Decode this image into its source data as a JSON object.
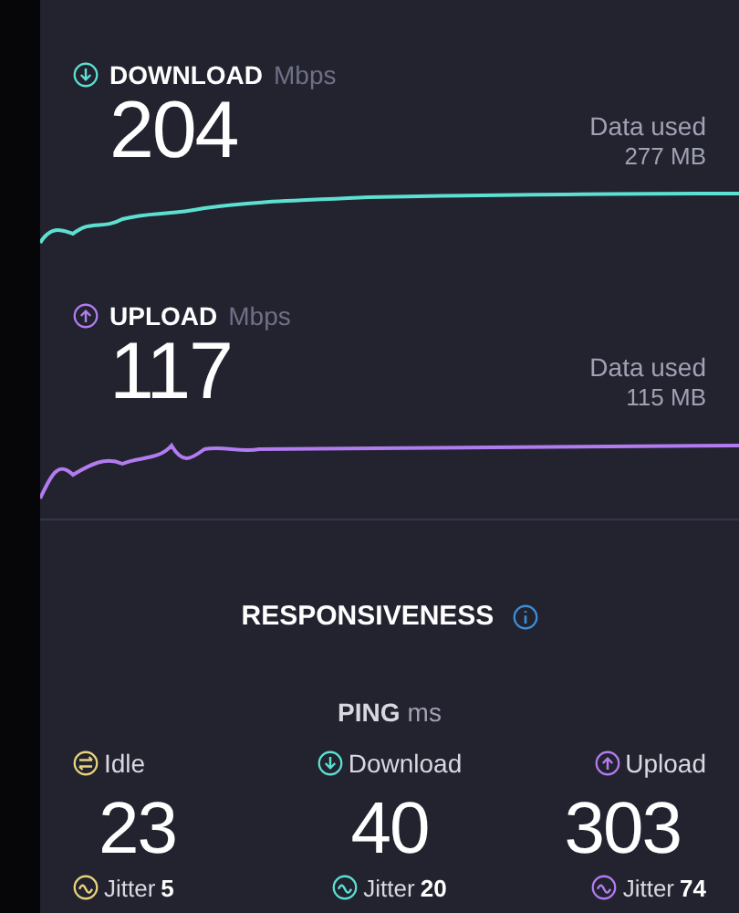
{
  "speed": [
    {
      "kind": "download",
      "label": "DOWNLOAD",
      "unit": "Mbps",
      "value": "204",
      "data_used_label": "Data used",
      "data_used": "277 MB",
      "color": "#5ce0d2"
    },
    {
      "kind": "upload",
      "label": "UPLOAD",
      "unit": "Mbps",
      "value": "117",
      "data_used_label": "Data used",
      "data_used": "115 MB",
      "color": "#b27cf0"
    }
  ],
  "responsiveness": {
    "title": "RESPONSIVENESS",
    "ping_label": "PING",
    "ping_unit": "ms",
    "columns": [
      {
        "kind": "idle",
        "label": "Idle",
        "value": "23",
        "jitter_label": "Jitter",
        "jitter": "5",
        "color": "#e8d27a"
      },
      {
        "kind": "download",
        "label": "Download",
        "value": "40",
        "jitter_label": "Jitter",
        "jitter": "20",
        "color": "#5ce0d2"
      },
      {
        "kind": "upload",
        "label": "Upload",
        "value": "303",
        "jitter_label": "Jitter",
        "jitter": "74",
        "color": "#b27cf0"
      }
    ]
  }
}
